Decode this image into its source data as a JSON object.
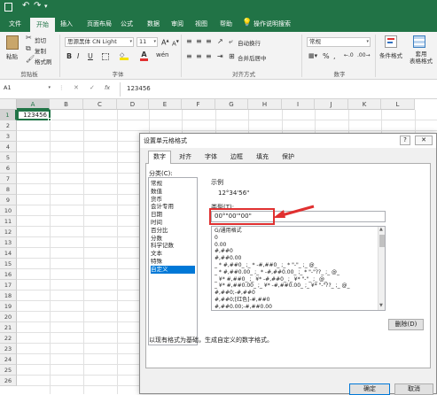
{
  "titlebar": {
    "save_icon": "save-icon",
    "undo_icon": "undo-icon",
    "redo_icon": "redo-icon"
  },
  "menu": {
    "tabs": [
      "文件",
      "开始",
      "插入",
      "页面布局",
      "公式",
      "数据",
      "审阅",
      "视图",
      "帮助"
    ],
    "search": "操作说明搜索"
  },
  "ribbon": {
    "paste": "粘贴",
    "cut": "剪切",
    "copy": "复制",
    "format_painter": "格式刷",
    "clipboard_group": "剪贴板",
    "font_name": "思源黑体 CN Light",
    "font_size": "11",
    "font_group": "字体",
    "bold": "B",
    "italic": "I",
    "underline": "U",
    "wrap_text": "自动换行",
    "merge_center": "合并后居中",
    "align_group": "对齐方式",
    "number_format": "常规",
    "number_group": "数字",
    "conditional_format": "条件格式",
    "format_as_table": "套用\n表格格式"
  },
  "formula_bar": {
    "name_box": "A1",
    "fx": "fx",
    "value": "123456"
  },
  "sheet": {
    "columns": [
      "A",
      "B",
      "C",
      "D",
      "E",
      "F",
      "G",
      "H",
      "I",
      "J",
      "K",
      "L"
    ],
    "rows": [
      "1",
      "2",
      "3",
      "4",
      "5",
      "6",
      "7",
      "8",
      "9",
      "10",
      "11",
      "12",
      "13",
      "14",
      "15",
      "16",
      "17",
      "18",
      "19",
      "20",
      "21",
      "22",
      "23",
      "24",
      "25",
      "26"
    ],
    "a1_value": "123456"
  },
  "dialog": {
    "title": "设置单元格格式",
    "help": "?",
    "close": "✕",
    "tabs": [
      "数字",
      "对齐",
      "字体",
      "边框",
      "填充",
      "保护"
    ],
    "category_label": "分类(C):",
    "categories": [
      "常规",
      "数值",
      "货币",
      "会计专用",
      "日期",
      "时间",
      "百分比",
      "分数",
      "科学记数",
      "文本",
      "特殊",
      "自定义"
    ],
    "selected_category": "自定义",
    "sample_label": "示例",
    "sample_value": "12°34'56\"",
    "type_label": "类型(T):",
    "type_value": "00°\"00'\"00\"",
    "formats": [
      "G/通用格式",
      "0",
      "0.00",
      "#,##0",
      "#,##0.00",
      "_ * #,##0_ ;_ * -#,##0_ ;_ * \"-\"_ ;_ @_",
      "_ * #,##0.00_ ;_ * -#,##0.00_ ;_ * \"-\"??_ ;_ @_",
      "_ ¥* #,##0_ ;_ ¥* -#,##0_ ;_ ¥* \"-\"_ ;_ @_",
      "_ ¥* #,##0.00_ ;_ ¥* -#,##0.00_ ;_ ¥* \"-\"??_ ;_ @_",
      "#,##0;-#,##0",
      "#,##0;[红色]-#,##0",
      "#,##0.00;-#,##0.00"
    ],
    "delete_button": "删除(D)",
    "description": "以现有格式为基础，生成自定义的数字格式。",
    "ok_button": "确定",
    "cancel_button": "取消"
  },
  "colors": {
    "accent": "#217346",
    "highlight": "#e03030",
    "selection": "#0078d7"
  }
}
